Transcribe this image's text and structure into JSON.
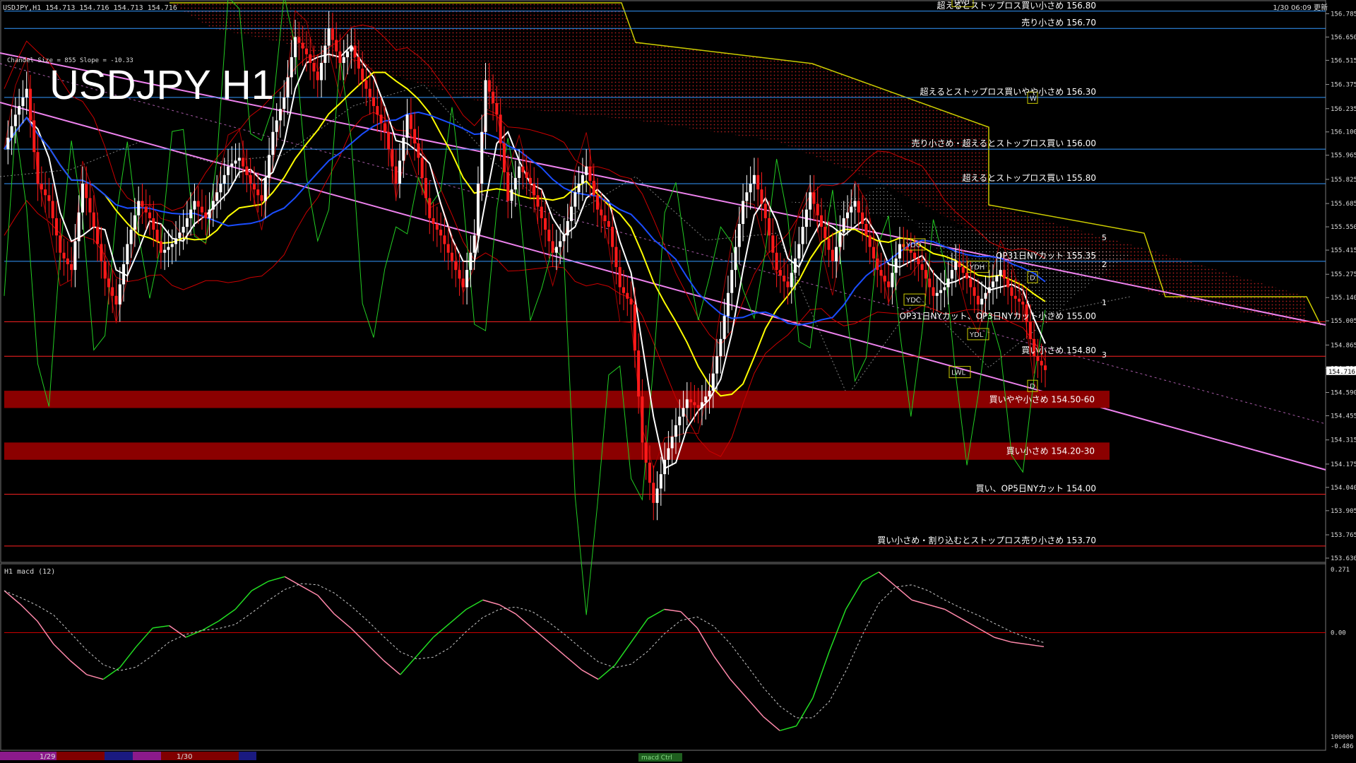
{
  "header": {
    "symbol_info": "USDJPY,H1  154.713 154.716 154.713 154.716",
    "title": "USDJPY H1",
    "updated": "1/30 06:09 更新",
    "channel_info": "Chandel Size = 855 Slope = -10.33",
    "macd_label": "H1  macd (12)"
  },
  "colors": {
    "background": "#000000",
    "bull_candle": "#ffffff",
    "bear_candle": "#ff1a1a",
    "channel": "#ee82ee",
    "fast_ma": "#ffffff",
    "mid_ma": "#ffff00",
    "slow_ma": "#1a4dff",
    "bollinger": "#cc0000",
    "chikou": "#22cc22",
    "cloud_edge": "#cccc00",
    "cloud_fill": "#cc2222",
    "zone_fill": "#8b0000",
    "macd_up": "#22dd22",
    "macd_down": "#ff88aa",
    "signal": "#cccccc"
  },
  "axis": {
    "price_ticks": [
      "156.785",
      "156.650",
      "156.515",
      "156.375",
      "156.235",
      "156.100",
      "155.965",
      "155.825",
      "155.685",
      "155.550",
      "155.415",
      "155.275",
      "155.140",
      "155.005",
      "154.865",
      "154.730",
      "154.590",
      "154.455",
      "154.315",
      "154.175",
      "154.040",
      "153.905",
      "153.765",
      "153.630"
    ],
    "current_price": "154.716",
    "macd_ticks": [
      "0.271",
      "0.00",
      "-0.486"
    ],
    "macd_scale": "100000",
    "date_ticks": [
      "1/29",
      "1/30"
    ],
    "footer_tag": "macd Ctrl"
  },
  "levels": [
    {
      "price": 156.8,
      "label": "超えるとストップロス買い小さめ 156.80",
      "color": "#3399ff"
    },
    {
      "price": 156.7,
      "label": "売り小さめ 156.70",
      "color": "#3399ff"
    },
    {
      "price": 156.3,
      "label": "超えるとストップロス買いやや小さめ 156.30",
      "color": "#3399ff"
    },
    {
      "price": 156.0,
      "label": "売り小さめ・超えるとストップロス買い 156.00",
      "color": "#3399ff"
    },
    {
      "price": 155.8,
      "label": "超えるとストップロス買い 155.80",
      "color": "#3399ff"
    },
    {
      "price": 155.35,
      "label": "OP31日NYカット 155.35",
      "color": "#3399ff"
    },
    {
      "price": 155.0,
      "label": "OP31日NYカット、OP3日NYカット小さめ 155.00",
      "color": "#ff2222"
    },
    {
      "price": 154.8,
      "label": "買い小さめ 154.80",
      "color": "#ff2222"
    },
    {
      "price": 154.0,
      "label": "買い、OP5日NYカット 154.00",
      "color": "#ff2222"
    },
    {
      "price": 153.7,
      "label": "買い小さめ・割り込むとストップロス売り小さめ 153.70",
      "color": "#ff2222"
    }
  ],
  "zones": [
    {
      "from": 154.5,
      "to": 154.6,
      "label": "買いやや小さめ 154.50-60"
    },
    {
      "from": 154.2,
      "to": 154.3,
      "label": "買い小さめ 154.20-30"
    }
  ],
  "markers": [
    {
      "text": "YDO",
      "price": 155.44
    },
    {
      "text": "YDH",
      "price": 155.31
    },
    {
      "text": "YDC",
      "price": 155.12
    },
    {
      "text": "YDL",
      "price": 154.92
    },
    {
      "text": "LWL",
      "price": 154.7
    },
    {
      "text": "LWH",
      "price": 156.85
    },
    {
      "text": "W",
      "price": 156.29
    },
    {
      "text": "D",
      "price": 155.25
    },
    {
      "text": "D",
      "price": 154.62
    }
  ],
  "wave_labels": [
    "5",
    "2",
    "1",
    "3"
  ],
  "chart_data": {
    "type": "line",
    "title": "USDJPY H1",
    "ylim": [
      153.63,
      156.84
    ],
    "x": [
      0,
      4,
      8,
      12,
      16,
      20,
      24,
      28,
      32,
      36,
      40,
      44,
      48,
      52,
      56,
      60,
      64,
      68,
      72,
      76,
      80,
      84,
      88,
      92,
      96,
      100,
      104,
      108,
      112,
      116,
      120,
      124,
      128,
      132,
      136,
      140,
      144,
      148,
      152,
      156,
      160,
      164,
      168,
      172,
      176,
      180,
      184,
      188,
      192,
      196,
      200,
      204,
      208,
      212,
      216,
      220,
      224,
      228,
      232,
      236,
      240,
      244,
      248,
      252,
      256,
      260,
      264,
      268,
      272,
      276,
      280,
      284,
      288,
      292,
      296,
      300,
      304,
      308,
      312,
      316,
      320,
      324,
      328,
      332,
      336,
      340,
      344,
      348,
      352,
      356,
      360,
      364,
      368,
      372
    ],
    "series": [
      {
        "values": [
          156.0,
          156.2,
          156.35,
          155.8,
          155.7,
          155.4,
          155.3,
          155.8,
          155.55,
          155.25,
          155.1,
          155.45,
          155.7,
          155.6,
          155.4,
          155.45,
          155.55,
          155.7,
          155.6,
          155.75,
          155.9,
          155.95,
          155.8,
          155.7,
          156.1,
          156.3,
          156.65,
          156.55,
          156.4,
          156.7,
          156.5,
          156.6,
          156.4,
          156.25,
          156.1,
          155.8,
          156.2,
          155.95,
          155.6,
          155.5,
          155.35,
          155.2,
          155.5,
          156.4,
          156.2,
          155.7,
          155.9,
          155.8,
          155.6,
          155.4,
          155.5,
          155.75,
          155.9,
          155.65,
          155.55,
          155.2,
          155.1,
          154.3,
          153.95,
          154.2,
          154.4,
          154.55,
          154.5,
          154.6,
          154.9,
          155.3,
          155.7,
          155.85,
          155.6,
          155.3,
          155.2,
          155.45,
          155.75,
          155.55,
          155.35,
          155.6,
          155.7,
          155.5,
          155.3,
          155.2,
          155.45,
          155.4,
          155.3,
          155.15,
          155.2,
          155.35,
          155.25,
          155.1,
          155.2,
          155.3,
          155.15,
          155.1,
          154.8,
          154.72
        ]
      }
    ],
    "levels": [
      156.8,
      156.7,
      156.3,
      156.0,
      155.8,
      155.35,
      155.0,
      154.8,
      154.0,
      153.7
    ],
    "macd": [
      0.18,
      0.12,
      0.05,
      -0.05,
      -0.12,
      -0.18,
      -0.2,
      -0.15,
      -0.06,
      0.02,
      0.03,
      -0.02,
      0.01,
      0.05,
      0.1,
      0.18,
      0.22,
      0.24,
      0.2,
      0.16,
      0.08,
      0.02,
      -0.05,
      -0.12,
      -0.18,
      -0.1,
      -0.02,
      0.04,
      0.1,
      0.14,
      0.12,
      0.08,
      0.02,
      -0.04,
      -0.1,
      -0.16,
      -0.2,
      -0.14,
      -0.04,
      0.06,
      0.1,
      0.09,
      0.02,
      -0.1,
      -0.2,
      -0.28,
      -0.36,
      -0.42,
      -0.4,
      -0.28,
      -0.08,
      0.1,
      0.22,
      0.26,
      0.2,
      0.14,
      0.12,
      0.1,
      0.06,
      0.02,
      -0.02,
      -0.04,
      -0.05,
      -0.06
    ],
    "macd_ylim": [
      -0.486,
      0.271
    ]
  }
}
